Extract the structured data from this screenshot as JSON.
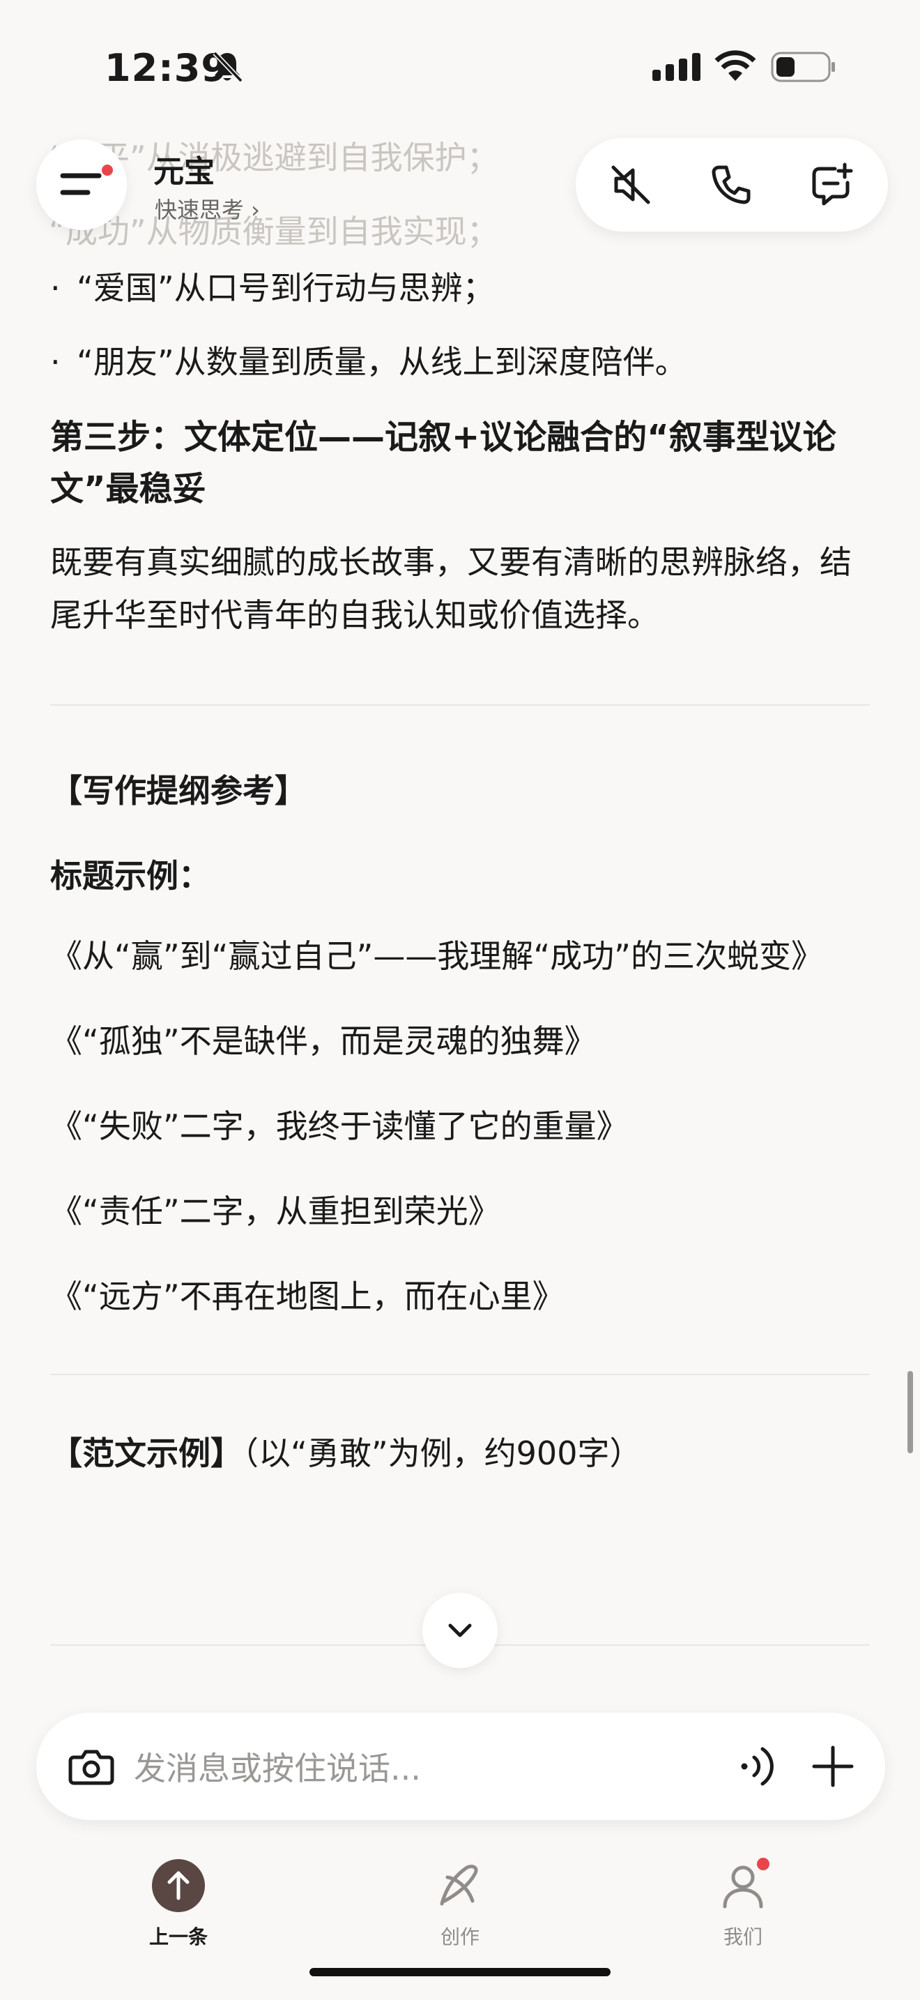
{
  "status_bar": {
    "time": "12:39"
  },
  "header": {
    "title": "元宝",
    "subtitle": "快速思考 ›"
  },
  "faded_lines": [
    "“躺平”从消极逃避到自我保护；",
    "“成功”从物质衡量到自我实现；"
  ],
  "content": {
    "bullets": [
      "“爱国”从口号到行动与思辨；",
      "“朋友”从数量到质量，从线上到深度陪伴。"
    ],
    "step3_heading": "第三步：文体定位——记叙+议论融合的“叙事型议论文”最稳妥",
    "step3_para": "既要有真实细腻的成长故事，又要有清晰的思辨脉络，结尾升华至时代青年的自我认知或价值选择。",
    "outline_heading": "【写作提纲参考】",
    "titles_label": "标题示例：",
    "title_examples": [
      "《从“赢”到“赢过自己”——我理解“成功”的三次蜕变》",
      "《“孤独”不是缺伴，而是灵魂的独舞》",
      "《“失败”二字，我终于读懂了它的重量》",
      "《“责任”二字，从重担到荣光》",
      "《“远方”不再在地图上，而在心里》"
    ],
    "sample_heading": "【范文示例】",
    "sample_note": "（以“勇敢”为例，约900字）"
  },
  "input": {
    "placeholder": "发消息或按住说话..."
  },
  "tabs": [
    {
      "label": "上一条"
    },
    {
      "label": "创作"
    },
    {
      "label": "我们"
    }
  ],
  "colors": {
    "accent": "#5a4744",
    "badge": "#e8454a",
    "background": "#f9f8f6"
  }
}
